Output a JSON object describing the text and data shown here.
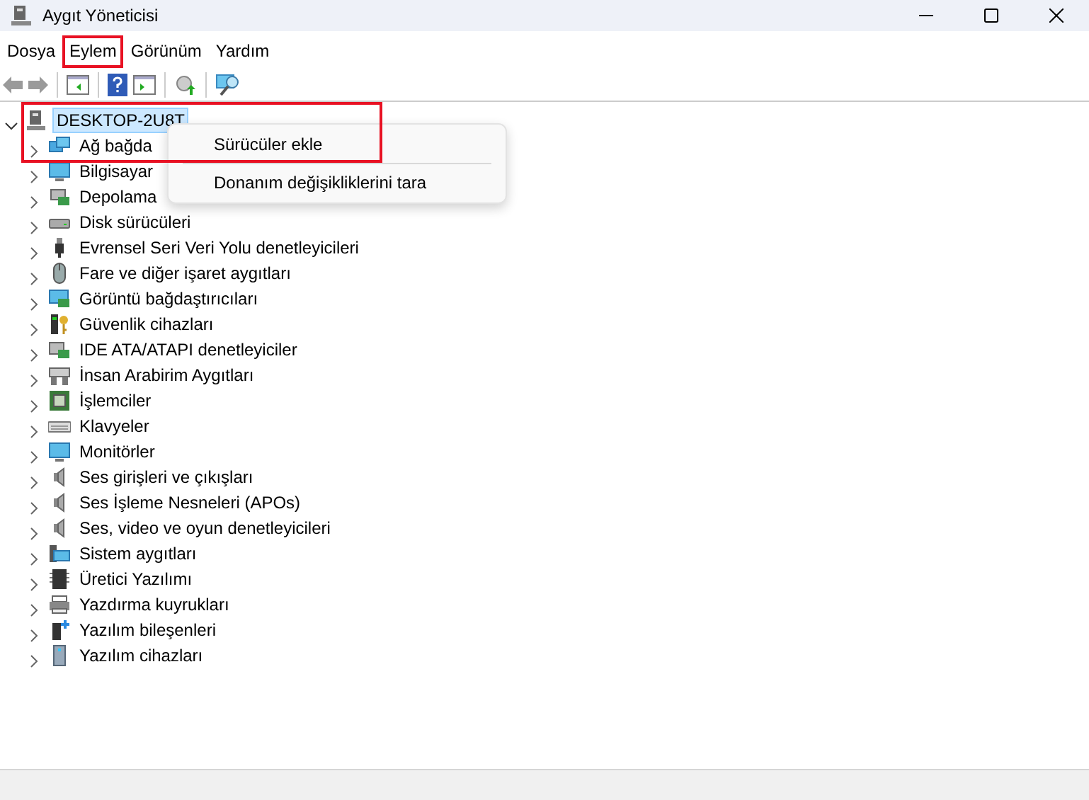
{
  "window": {
    "title": "Aygıt Yöneticisi"
  },
  "menu": [
    {
      "label": "Dosya",
      "highlighted": false
    },
    {
      "label": "Eylem",
      "highlighted": true
    },
    {
      "label": "Görünüm",
      "highlighted": false
    },
    {
      "label": "Yardım",
      "highlighted": false
    }
  ],
  "tree": {
    "root": {
      "label": "DESKTOP-2U8T",
      "expanded": true,
      "selected": true,
      "highlighted": true
    },
    "children": [
      {
        "label": "Ağ bağda"
      },
      {
        "label": "Bilgisayar"
      },
      {
        "label": "Depolama"
      },
      {
        "label": "Disk sürücüleri"
      },
      {
        "label": "Evrensel Seri Veri Yolu denetleyicileri"
      },
      {
        "label": "Fare ve diğer işaret aygıtları"
      },
      {
        "label": "Görüntü bağdaştırıcıları"
      },
      {
        "label": "Güvenlik cihazları"
      },
      {
        "label": "IDE ATA/ATAPI denetleyiciler"
      },
      {
        "label": "İnsan Arabirim Aygıtları"
      },
      {
        "label": "İşlemciler"
      },
      {
        "label": "Klavyeler"
      },
      {
        "label": "Monitörler"
      },
      {
        "label": "Ses girişleri ve çıkışları"
      },
      {
        "label": "Ses İşleme Nesneleri (APOs)"
      },
      {
        "label": "Ses, video ve oyun denetleyicileri"
      },
      {
        "label": "Sistem aygıtları"
      },
      {
        "label": "Üretici Yazılımı"
      },
      {
        "label": "Yazdırma kuyrukları"
      },
      {
        "label": "Yazılım bileşenleri"
      },
      {
        "label": "Yazılım cihazları"
      }
    ]
  },
  "context_menu": [
    {
      "label": "Sürücüler ekle"
    },
    {
      "kind": "separator"
    },
    {
      "label": "Donanım değişikliklerini tara"
    }
  ]
}
